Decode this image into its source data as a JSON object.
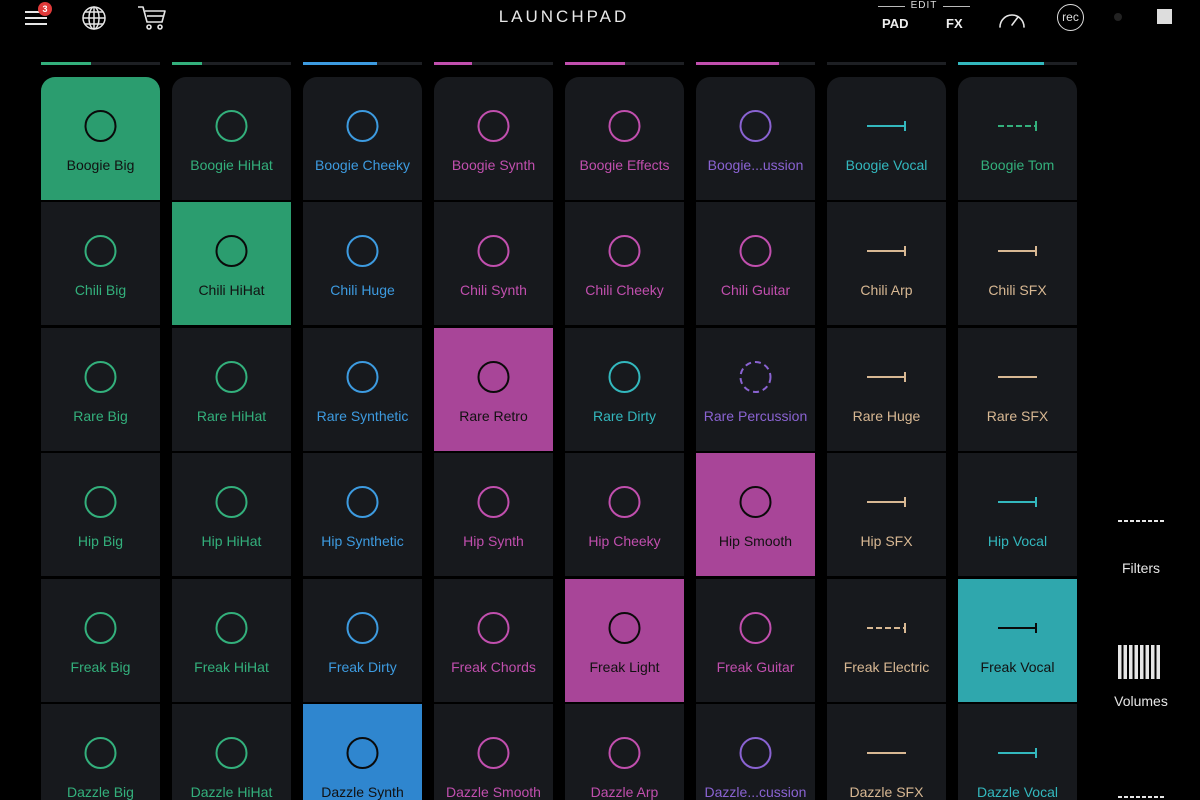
{
  "app": {
    "title": "LAUNCHPAD"
  },
  "header": {
    "menu_badge": "3",
    "icons": [
      "menu-icon",
      "globe-icon",
      "cart-icon",
      "speed-gauge-icon"
    ],
    "mode": {
      "edit_label": "EDIT",
      "pad_label": "PAD",
      "fx_label": "FX"
    },
    "rec_label": "rec"
  },
  "colors": {
    "background": "#000000",
    "pad": "#17191d",
    "green": "#2b9d6f",
    "green_text": "#33b07c",
    "blue": "#2f86cf",
    "blue_text": "#3d9be0",
    "magenta": "#a84598",
    "magenta_text": "#c14fae",
    "purple_text": "#8a63d2",
    "tan_text": "#d8b893",
    "teal": "#2fa7ad",
    "teal_text": "#33b8be"
  },
  "columns": [
    {
      "color": "green",
      "progress": 0.42
    },
    {
      "color": "green",
      "progress": 0.25
    },
    {
      "color": "blue",
      "progress": 0.62
    },
    {
      "color": "magenta",
      "progress": 0.32
    },
    {
      "color": "magenta",
      "progress": 0.5
    },
    {
      "color": "magenta",
      "progress": 0.7
    },
    {
      "color": "blue",
      "progress": 0.0
    },
    {
      "color": "teal",
      "progress": 0.72
    }
  ],
  "pads": [
    [
      {
        "label": "Boogie Big",
        "color": "green",
        "icon": "circle",
        "active": true
      },
      {
        "label": "Boogie HiHat",
        "color": "green",
        "icon": "circle",
        "active": false
      },
      {
        "label": "Boogie Cheeky",
        "color": "blue",
        "icon": "circle",
        "active": false
      },
      {
        "label": "Boogie Synth",
        "color": "magenta",
        "icon": "circle",
        "active": false
      },
      {
        "label": "Boogie Effects",
        "color": "magenta",
        "icon": "circle",
        "active": false
      },
      {
        "label": "Boogie...ussion",
        "color": "purple",
        "icon": "circle",
        "active": false
      },
      {
        "label": "Boogie Vocal",
        "color": "teal",
        "icon": "line-end",
        "active": false
      },
      {
        "label": "Boogie Tom",
        "color": "green",
        "icon": "dashed-line-end",
        "active": false
      }
    ],
    [
      {
        "label": "Chili Big",
        "color": "green",
        "icon": "circle",
        "active": false
      },
      {
        "label": "Chili HiHat",
        "color": "green",
        "icon": "circle",
        "active": true
      },
      {
        "label": "Chili Huge",
        "color": "blue",
        "icon": "circle",
        "active": false
      },
      {
        "label": "Chili Synth",
        "color": "magenta",
        "icon": "circle",
        "active": false
      },
      {
        "label": "Chili Cheeky",
        "color": "magenta",
        "icon": "circle",
        "active": false
      },
      {
        "label": "Chili Guitar",
        "color": "magenta",
        "icon": "circle",
        "active": false
      },
      {
        "label": "Chili Arp",
        "color": "tan",
        "icon": "line-end",
        "active": false
      },
      {
        "label": "Chili SFX",
        "color": "tan",
        "icon": "line-end",
        "active": false
      }
    ],
    [
      {
        "label": "Rare Big",
        "color": "green",
        "icon": "circle",
        "active": false
      },
      {
        "label": "Rare HiHat",
        "color": "green",
        "icon": "circle",
        "active": false
      },
      {
        "label": "Rare Synthetic",
        "color": "blue",
        "icon": "circle",
        "active": false
      },
      {
        "label": "Rare Retro",
        "color": "magenta",
        "icon": "circle",
        "active": true
      },
      {
        "label": "Rare Dirty",
        "color": "teal",
        "icon": "circle",
        "active": false
      },
      {
        "label": "Rare Percussion",
        "color": "purple",
        "icon": "dashed-circle",
        "active": false
      },
      {
        "label": "Rare Huge",
        "color": "tan",
        "icon": "line-end",
        "active": false
      },
      {
        "label": "Rare SFX",
        "color": "tan",
        "icon": "line",
        "active": false
      }
    ],
    [
      {
        "label": "Hip Big",
        "color": "green",
        "icon": "circle",
        "active": false
      },
      {
        "label": "Hip HiHat",
        "color": "green",
        "icon": "circle",
        "active": false
      },
      {
        "label": "Hip Synthetic",
        "color": "blue",
        "icon": "circle",
        "active": false
      },
      {
        "label": "Hip Synth",
        "color": "magenta",
        "icon": "circle",
        "active": false
      },
      {
        "label": "Hip Cheeky",
        "color": "magenta",
        "icon": "circle",
        "active": false
      },
      {
        "label": "Hip Smooth",
        "color": "magenta",
        "icon": "circle",
        "active": true
      },
      {
        "label": "Hip SFX",
        "color": "tan",
        "icon": "line-end",
        "active": false
      },
      {
        "label": "Hip Vocal",
        "color": "teal",
        "icon": "line-end",
        "active": false
      }
    ],
    [
      {
        "label": "Freak Big",
        "color": "green",
        "icon": "circle",
        "active": false
      },
      {
        "label": "Freak HiHat",
        "color": "green",
        "icon": "circle",
        "active": false
      },
      {
        "label": "Freak Dirty",
        "color": "blue",
        "icon": "circle",
        "active": false
      },
      {
        "label": "Freak Chords",
        "color": "magenta",
        "icon": "circle",
        "active": false
      },
      {
        "label": "Freak Light",
        "color": "magenta",
        "icon": "circle",
        "active": true
      },
      {
        "label": "Freak Guitar",
        "color": "magenta",
        "icon": "circle",
        "active": false
      },
      {
        "label": "Freak Electric",
        "color": "tan",
        "icon": "dashed-line-end",
        "active": false
      },
      {
        "label": "Freak Vocal",
        "color": "teal",
        "icon": "line-end",
        "active": true
      }
    ],
    [
      {
        "label": "Dazzle Big",
        "color": "green",
        "icon": "circle",
        "active": false
      },
      {
        "label": "Dazzle HiHat",
        "color": "green",
        "icon": "circle",
        "active": false
      },
      {
        "label": "Dazzle Synth",
        "color": "blue",
        "icon": "circle",
        "active": true
      },
      {
        "label": "Dazzle Smooth",
        "color": "magenta",
        "icon": "circle",
        "active": false
      },
      {
        "label": "Dazzle Arp",
        "color": "magenta",
        "icon": "circle",
        "active": false
      },
      {
        "label": "Dazzle...cussion",
        "color": "purple",
        "icon": "circle",
        "active": false
      },
      {
        "label": "Dazzle SFX",
        "color": "tan",
        "icon": "line",
        "active": false
      },
      {
        "label": "Dazzle Vocal",
        "color": "teal",
        "icon": "line-end",
        "active": false
      }
    ]
  ],
  "sidebar": {
    "filters_label": "Filters",
    "volumes_label": "Volumes",
    "icons": [
      "filters-icon",
      "volumes-icon",
      "more-icon"
    ]
  }
}
